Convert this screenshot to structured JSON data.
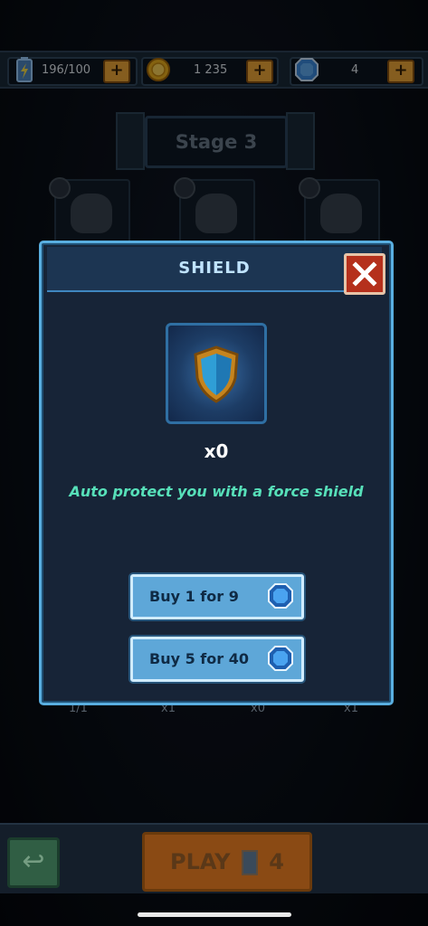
{
  "resources": {
    "energy": "196/100",
    "coins": "1 235",
    "gems": "4",
    "add_label": "+"
  },
  "stage": {
    "label": "Stage 3"
  },
  "level_stats": [
    "1/1",
    "x1",
    "x0",
    "x1"
  ],
  "bottom_bar": {
    "play_label": "PLAY",
    "play_cost": "4"
  },
  "modal": {
    "title": "SHIELD",
    "count": "x0",
    "description": "Auto protect you with a force shield",
    "buy_options": [
      {
        "label": "Buy 1 for 9",
        "icon": "gem-icon"
      },
      {
        "label": "Buy 5 for 40",
        "icon": "gem-icon"
      }
    ]
  },
  "colors": {
    "modal_border": "#59aee0",
    "description_text": "#57e0b9",
    "buy_button": "#5ea7d8",
    "close_button": "#b5301c",
    "plus_button": "#f2a93a"
  }
}
